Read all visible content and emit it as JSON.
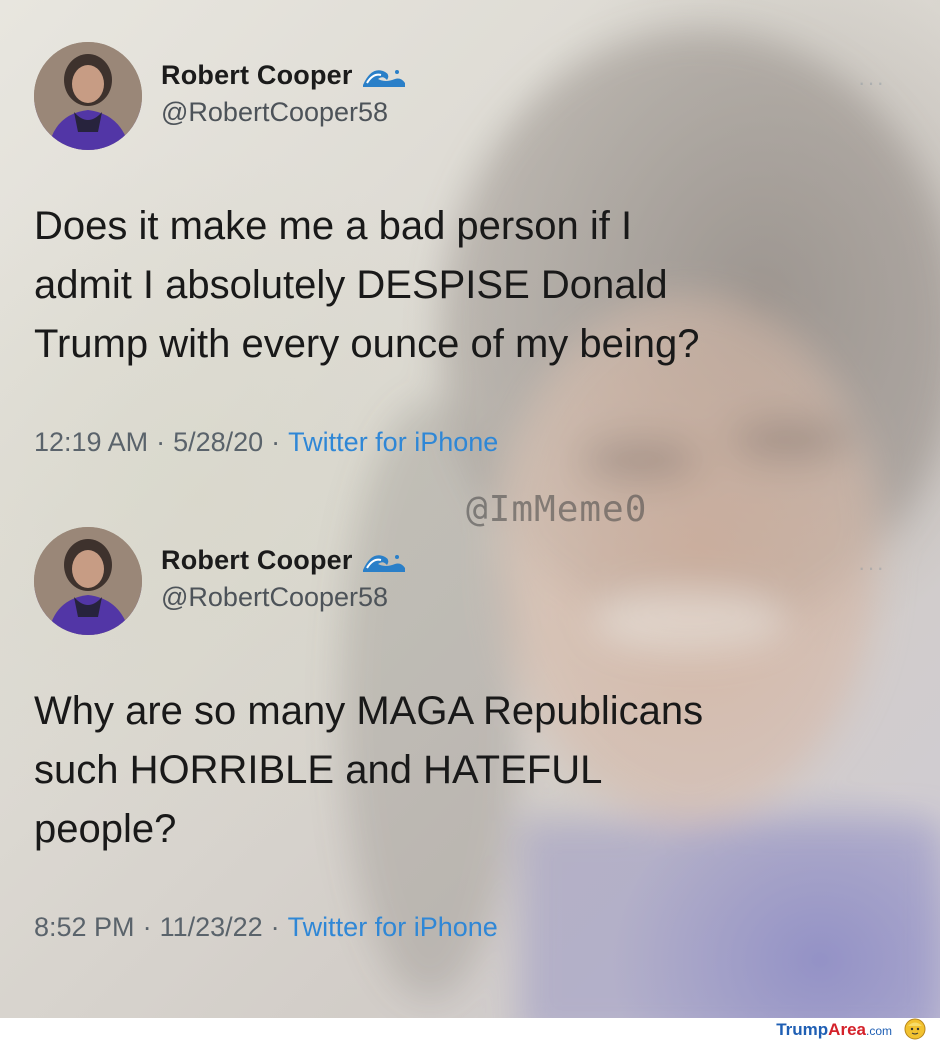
{
  "tweets": [
    {
      "display_name": "Robert Cooper",
      "name_icon": "wave-emoji-icon",
      "handle": "@RobertCooper58",
      "text_lines": [
        "Does it make me a bad person if I",
        "admit I absolutely DESPISE Donald",
        "Trump with every ounce of my being?"
      ],
      "time": "12:19 AM",
      "date": "5/28/20",
      "source": "Twitter for iPhone",
      "separator": "·"
    },
    {
      "display_name": "Robert Cooper",
      "name_icon": "wave-emoji-icon",
      "handle": "@RobertCooper58",
      "text_lines": [
        "Why are so many MAGA Republicans",
        "such HORRIBLE and HATEFUL",
        "people?"
      ],
      "time": "8:52 PM",
      "date": "11/23/22",
      "source": "Twitter for iPhone",
      "separator": "·"
    }
  ],
  "watermark": "@ImMeme0",
  "more_glyph": "···",
  "footer": {
    "brand_part1": "Trump",
    "brand_part2": "Area",
    "brand_suffix": ".com"
  },
  "colors": {
    "source_link": "#2f87d6",
    "meta_text": "#5a636b",
    "brand_blue": "#1f5fb4",
    "brand_red": "#d4212a"
  }
}
